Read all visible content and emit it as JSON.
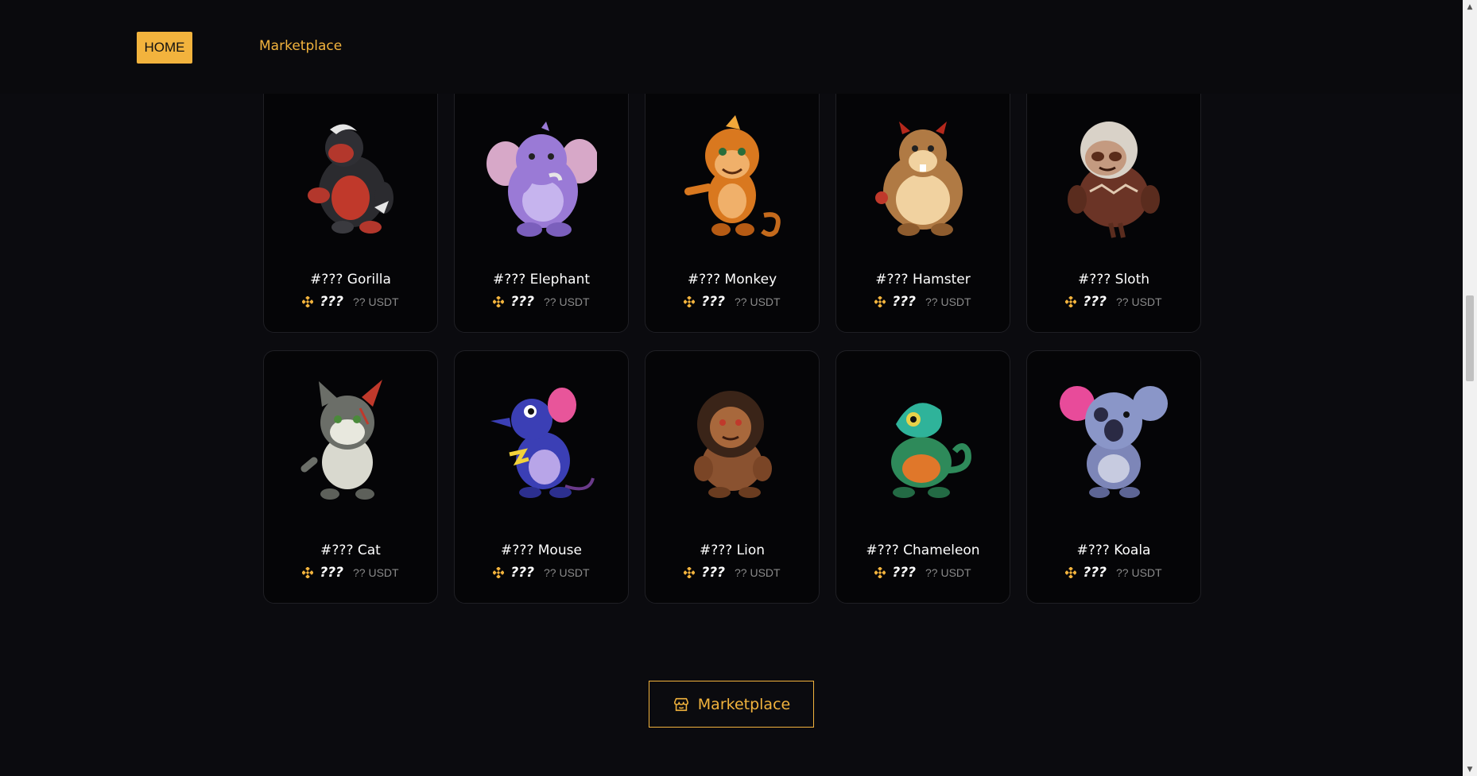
{
  "header": {
    "home_label": "HOME",
    "marketplace_label": "Marketplace"
  },
  "cards": [
    {
      "name": "#??? Gorilla",
      "coin": "???",
      "usdt": "?? USDT",
      "icon": "gorilla-icon"
    },
    {
      "name": "#??? Elephant",
      "coin": "???",
      "usdt": "?? USDT",
      "icon": "elephant-icon"
    },
    {
      "name": "#??? Monkey",
      "coin": "???",
      "usdt": "?? USDT",
      "icon": "monkey-icon"
    },
    {
      "name": "#??? Hamster",
      "coin": "???",
      "usdt": "?? USDT",
      "icon": "hamster-icon"
    },
    {
      "name": "#??? Sloth",
      "coin": "???",
      "usdt": "?? USDT",
      "icon": "sloth-icon"
    },
    {
      "name": "#??? Cat",
      "coin": "???",
      "usdt": "?? USDT",
      "icon": "cat-icon"
    },
    {
      "name": "#??? Mouse",
      "coin": "???",
      "usdt": "?? USDT",
      "icon": "mouse-icon"
    },
    {
      "name": "#??? Lion",
      "coin": "???",
      "usdt": "?? USDT",
      "icon": "lion-icon"
    },
    {
      "name": "#??? Chameleon",
      "coin": "???",
      "usdt": "?? USDT",
      "icon": "chameleon-icon"
    },
    {
      "name": "#??? Koala",
      "coin": "???",
      "usdt": "?? USDT",
      "icon": "koala-icon"
    }
  ],
  "footer": {
    "marketplace_button_label": "Marketplace"
  },
  "colors": {
    "accent": "#f2b33d",
    "background": "#0b0b0f",
    "card": "#050507"
  }
}
